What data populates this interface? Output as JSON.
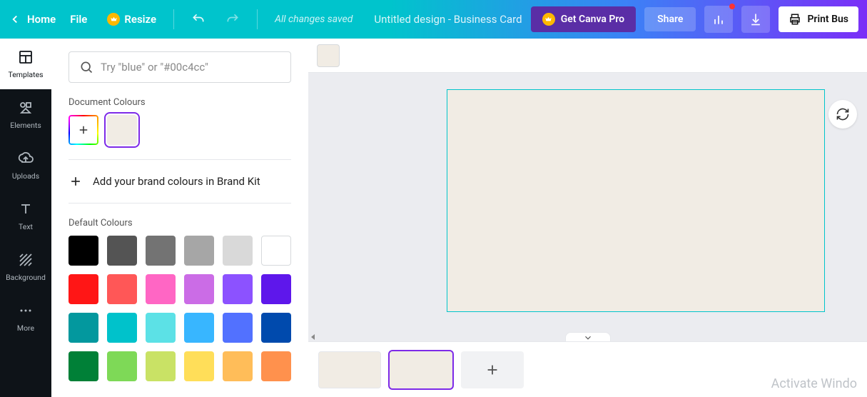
{
  "topbar": {
    "home": "Home",
    "file": "File",
    "resize": "Resize",
    "status": "All changes saved",
    "title": "Untitled design - Business Card",
    "pro": "Get Canva Pro",
    "share": "Share",
    "print": "Print Bus"
  },
  "rail": {
    "templates": "Templates",
    "elements": "Elements",
    "uploads": "Uploads",
    "text": "Text",
    "background": "Background",
    "more": "More"
  },
  "panel": {
    "search_placeholder": "Try \"blue\" or \"#00c4cc\"",
    "doc_colours_label": "Document Colours",
    "brand_kit_text": "Add your brand colours in Brand Kit",
    "default_colours_label": "Default Colours",
    "doc_colour": "#f1ece4",
    "default_colours": [
      "#000000",
      "#545454",
      "#737373",
      "#a6a6a6",
      "#d9d9d9",
      "#ffffff",
      "#ff1616",
      "#ff5757",
      "#ff66c4",
      "#cb6ce6",
      "#8c52ff",
      "#5e17eb",
      "#03989e",
      "#00c2cb",
      "#5ce1e6",
      "#38b6ff",
      "#5271ff",
      "#004aad",
      "#008037",
      "#7ed957",
      "#c9e265",
      "#ffde59",
      "#ffbd59",
      "#ff914d"
    ]
  },
  "canvas": {
    "current_color": "#f1ece4",
    "page_count": 2,
    "selected_page": 2
  },
  "watermark": "Activate Windo"
}
